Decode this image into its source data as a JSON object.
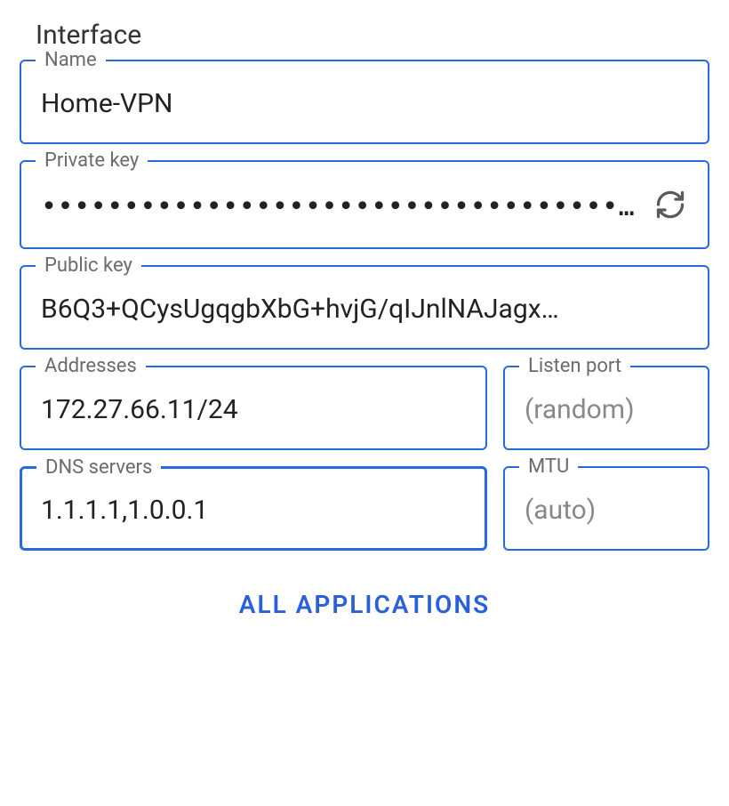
{
  "section": {
    "title": "Interface"
  },
  "fields": {
    "name": {
      "label": "Name",
      "value": "Home-VPN"
    },
    "private_key": {
      "label": "Private key",
      "masked_value": "••••••••••••••••••••••••••••••••••••••••••••"
    },
    "public_key": {
      "label": "Public key",
      "value": "B6Q3+QCysUgqgbXbG+hvjG/qIJnlNAJagx…"
    },
    "addresses": {
      "label": "Addresses",
      "value": "172.27.66.11/24"
    },
    "listen_port": {
      "label": "Listen port",
      "placeholder": "(random)",
      "value": ""
    },
    "dns_servers": {
      "label": "DNS servers",
      "value": "1.1.1.1,1.0.0.1"
    },
    "mtu": {
      "label": "MTU",
      "placeholder": "(auto)",
      "value": ""
    }
  },
  "buttons": {
    "all_applications": "ALL APPLICATIONS"
  }
}
